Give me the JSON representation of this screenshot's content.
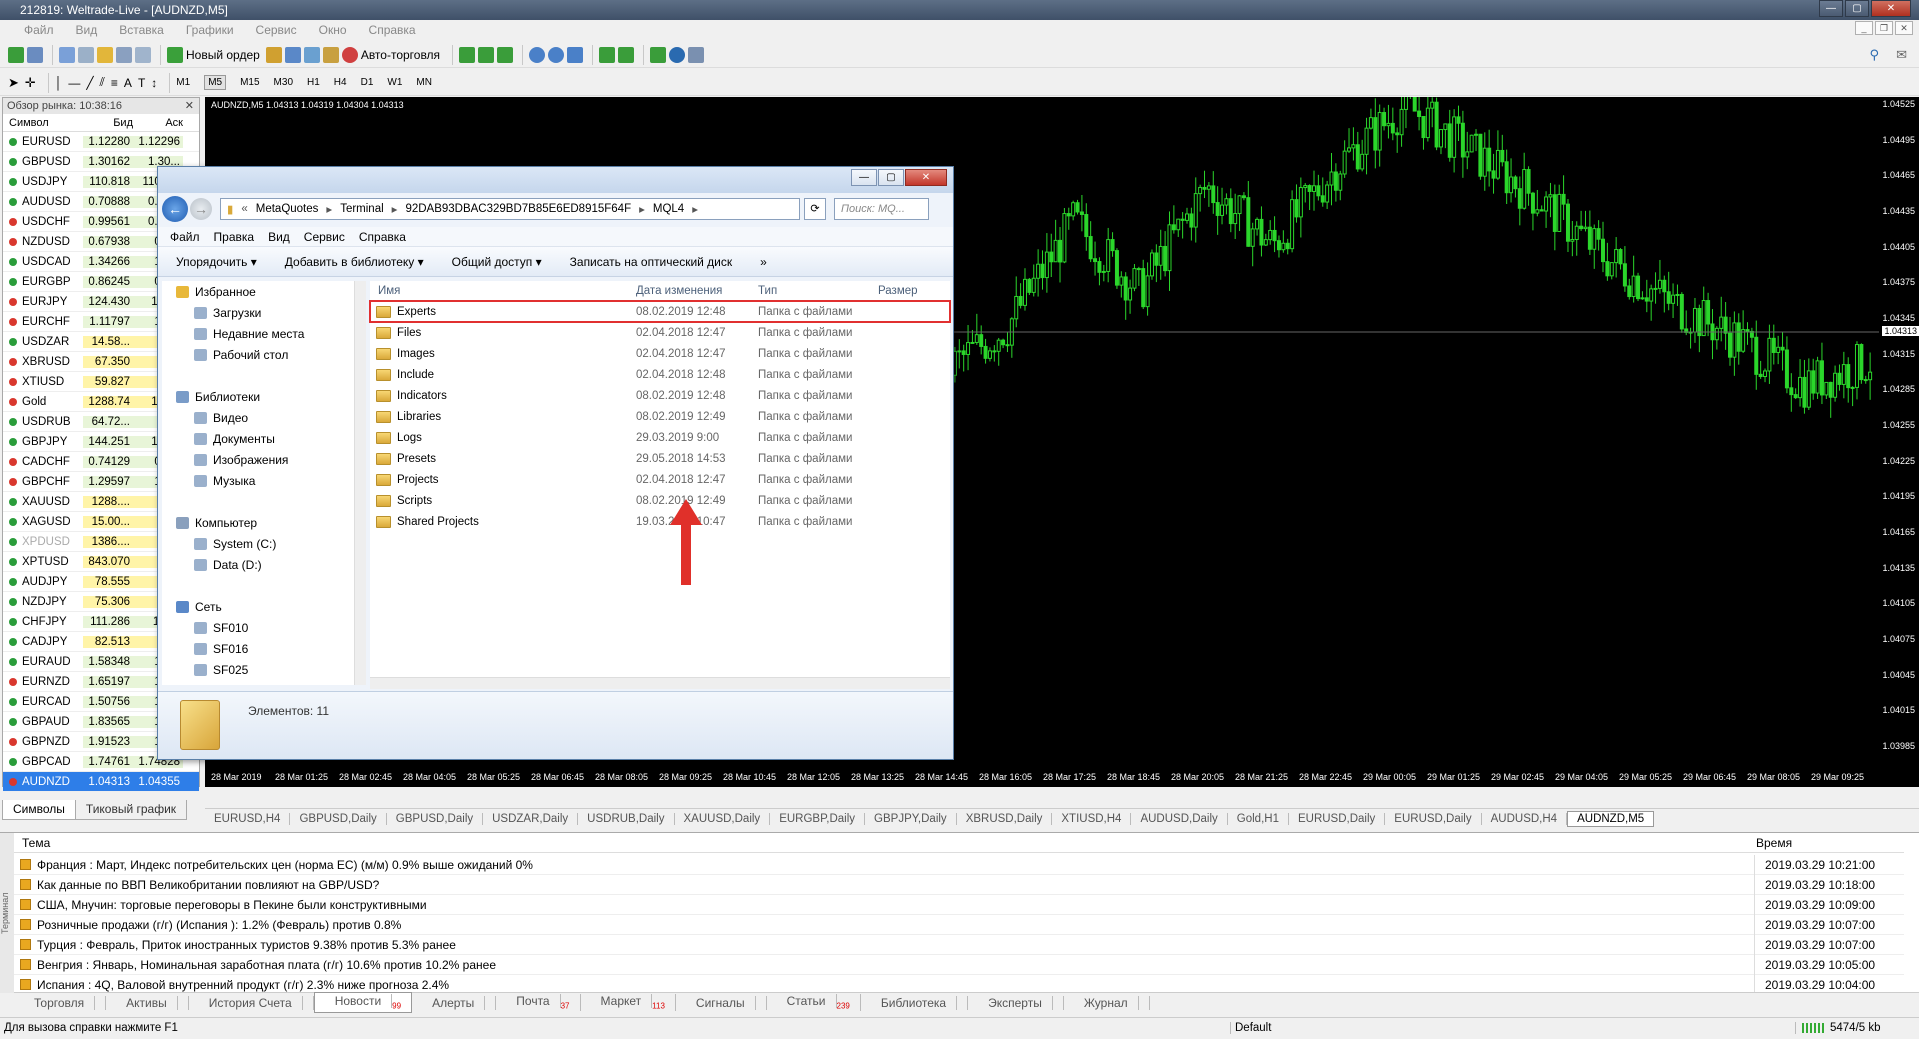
{
  "window": {
    "title": "212819: Weltrade-Live - [AUDNZD,M5]"
  },
  "menu": [
    "Файл",
    "Вид",
    "Вставка",
    "Графики",
    "Сервис",
    "Окно",
    "Справка"
  ],
  "toolbar": {
    "new_order": "Новый ордер",
    "autotrading": "Авто-торговля"
  },
  "timeframes": [
    "M1",
    "M5",
    "M15",
    "M30",
    "H1",
    "H4",
    "D1",
    "W1",
    "MN"
  ],
  "selected_timeframe": "M5",
  "market_watch": {
    "title": "Обзор рынка: 10:38:16",
    "cols": {
      "symbol": "Символ",
      "bid": "Бид",
      "ask": "Аск"
    },
    "rows": [
      {
        "s": "EURUSD",
        "b": "1.12280",
        "a": "1.12296"
      },
      {
        "s": "GBPUSD",
        "b": "1.30162",
        "a": "1.30..."
      },
      {
        "s": "USDJPY",
        "b": "110.818",
        "a": "110.8..."
      },
      {
        "s": "AUDUSD",
        "b": "0.70888",
        "a": "0.70..."
      },
      {
        "s": "USDCHF",
        "b": "0.99561",
        "a": "0.99..."
      },
      {
        "s": "NZDUSD",
        "b": "0.67938",
        "a": "0.6..."
      },
      {
        "s": "USDCAD",
        "b": "1.34266",
        "a": "1.3..."
      },
      {
        "s": "EURGBP",
        "b": "0.86245",
        "a": "0.8..."
      },
      {
        "s": "EURJPY",
        "b": "124.430",
        "a": "124..."
      },
      {
        "s": "EURCHF",
        "b": "1.11797",
        "a": "1.1..."
      },
      {
        "s": "USDZAR",
        "b": "14.58...",
        "a": "14..."
      },
      {
        "s": "XBRUSD",
        "b": "67.350",
        "a": "67..."
      },
      {
        "s": "XTIUSD",
        "b": "59.827",
        "a": "59..."
      },
      {
        "s": "Gold",
        "b": "1288.74",
        "a": "128..."
      },
      {
        "s": "USDRUB",
        "b": "64.72...",
        "a": "64..."
      },
      {
        "s": "GBPJPY",
        "b": "144.251",
        "a": "144..."
      },
      {
        "s": "CADCHF",
        "b": "0.74129",
        "a": "0.7..."
      },
      {
        "s": "GBPCHF",
        "b": "1.29597",
        "a": "1.2..."
      },
      {
        "s": "XAUUSD",
        "b": "1288....",
        "a": "12..."
      },
      {
        "s": "XAGUSD",
        "b": "15.00...",
        "a": "15..."
      },
      {
        "s": "XPDUSD",
        "b": "1386....",
        "a": "13..."
      },
      {
        "s": "XPTUSD",
        "b": "843.070",
        "a": "84..."
      },
      {
        "s": "AUDJPY",
        "b": "78.555",
        "a": "78..."
      },
      {
        "s": "NZDJPY",
        "b": "75.306",
        "a": "75..."
      },
      {
        "s": "CHFJPY",
        "b": "111.286",
        "a": "111..."
      },
      {
        "s": "CADJPY",
        "b": "82.513",
        "a": "82..."
      },
      {
        "s": "EURAUD",
        "b": "1.58348",
        "a": "1.5..."
      },
      {
        "s": "EURNZD",
        "b": "1.65197",
        "a": "1.6..."
      },
      {
        "s": "EURCAD",
        "b": "1.50756",
        "a": "1.5..."
      },
      {
        "s": "GBPAUD",
        "b": "1.83565",
        "a": "1.8..."
      },
      {
        "s": "GBPNZD",
        "b": "1.91523",
        "a": "1.9..."
      },
      {
        "s": "GBPCAD",
        "b": "1.74761",
        "a": "1.74828"
      },
      {
        "s": "AUDNZD",
        "b": "1.04313",
        "a": "1.04355"
      }
    ],
    "tabs": [
      "Символы",
      "Тиковый график"
    ]
  },
  "chart": {
    "info": "AUDNZD,M5 1.04313 1.04319 1.04304 1.04313",
    "price_label": "1.04313"
  },
  "chart_data": {
    "type": "line",
    "yticks": [
      "1.04525",
      "1.04495",
      "1.04465",
      "1.04435",
      "1.04405",
      "1.04375",
      "1.04345",
      "1.04315",
      "1.04285",
      "1.04255",
      "1.04225",
      "1.04195",
      "1.04165",
      "1.04135",
      "1.04105",
      "1.04075",
      "1.04045",
      "1.04015",
      "1.03985"
    ],
    "xticks": [
      "28 Mar 2019",
      "28 Mar 01:25",
      "28 Mar 02:45",
      "28 Mar 04:05",
      "28 Mar 05:25",
      "28 Mar 06:45",
      "28 Mar 08:05",
      "28 Mar 09:25",
      "28 Mar 10:45",
      "28 Mar 12:05",
      "28 Mar 13:25",
      "28 Mar 14:45",
      "28 Mar 16:05",
      "28 Mar 17:25",
      "28 Mar 18:45",
      "28 Mar 20:05",
      "28 Mar 21:25",
      "28 Mar 22:45",
      "29 Mar 00:05",
      "29 Mar 01:25",
      "29 Mar 02:45",
      "29 Mar 04:05",
      "29 Mar 05:25",
      "29 Mar 06:45",
      "29 Mar 08:05",
      "29 Mar 09:25"
    ],
    "ylim": [
      1.0398,
      1.0453
    ],
    "series": [
      {
        "values": [
          1.0408,
          1.0412,
          1.0418,
          1.0424,
          1.0431,
          1.0421,
          1.0413,
          1.0409,
          1.0415,
          1.0422,
          1.0427,
          1.043,
          1.0434,
          1.0443,
          1.0437,
          1.0446,
          1.0441,
          1.0448,
          1.0453,
          1.0449,
          1.0445,
          1.044,
          1.0436,
          1.0433,
          1.0429,
          1.0431
        ]
      }
    ]
  },
  "chart_tabs": [
    "EURUSD,H4",
    "GBPUSD,Daily",
    "GBPUSD,Daily",
    "USDZAR,Daily",
    "USDRUB,Daily",
    "XAUUSD,Daily",
    "EURGBP,Daily",
    "GBPJPY,Daily",
    "XBRUSD,Daily",
    "XTIUSD,H4",
    "AUDUSD,Daily",
    "Gold,H1",
    "EURUSD,Daily",
    "EURUSD,Daily",
    "AUDUSD,H4",
    "AUDNZD,M5"
  ],
  "explorer": {
    "path": [
      "MetaQuotes",
      "Terminal",
      "92DAB93DBAC329BD7B85E6ED8915F64F",
      "MQL4"
    ],
    "search_placeholder": "Поиск: MQ...",
    "menu": [
      "Файл",
      "Правка",
      "Вид",
      "Сервис",
      "Справка"
    ],
    "commands": [
      "Упорядочить ▾",
      "Добавить в библиотеку ▾",
      "Общий доступ ▾",
      "Записать на оптический диск",
      "»"
    ],
    "nav": [
      {
        "t": "Избранное",
        "lvl": "g"
      },
      {
        "t": "Загрузки",
        "lvl": "s"
      },
      {
        "t": "Недавние места",
        "lvl": "s"
      },
      {
        "t": "Рабочий стол",
        "lvl": "s"
      },
      {
        "t": "",
        "lvl": "g"
      },
      {
        "t": "Библиотеки",
        "lvl": "g"
      },
      {
        "t": "Видео",
        "lvl": "s"
      },
      {
        "t": "Документы",
        "lvl": "s"
      },
      {
        "t": "Изображения",
        "lvl": "s"
      },
      {
        "t": "Музыка",
        "lvl": "s"
      },
      {
        "t": "",
        "lvl": "g"
      },
      {
        "t": "Компьютер",
        "lvl": "g"
      },
      {
        "t": "System (C:)",
        "lvl": "s"
      },
      {
        "t": "Data (D:)",
        "lvl": "s"
      },
      {
        "t": "",
        "lvl": "g"
      },
      {
        "t": "Сеть",
        "lvl": "g"
      },
      {
        "t": "SF010",
        "lvl": "s"
      },
      {
        "t": "SF016",
        "lvl": "s"
      },
      {
        "t": "SF025",
        "lvl": "s"
      }
    ],
    "cols": {
      "name": "Имя",
      "date": "Дата изменения",
      "type": "Тип",
      "size": "Размер"
    },
    "files": [
      {
        "n": "Experts",
        "d": "08.02.2019 12:48",
        "k": "Папка с файлами"
      },
      {
        "n": "Files",
        "d": "02.04.2018 12:47",
        "k": "Папка с файлами"
      },
      {
        "n": "Images",
        "d": "02.04.2018 12:47",
        "k": "Папка с файлами"
      },
      {
        "n": "Include",
        "d": "02.04.2018 12:48",
        "k": "Папка с файлами"
      },
      {
        "n": "Indicators",
        "d": "08.02.2019 12:48",
        "k": "Папка с файлами"
      },
      {
        "n": "Libraries",
        "d": "08.02.2019 12:49",
        "k": "Папка с файлами"
      },
      {
        "n": "Logs",
        "d": "29.03.2019 9:00",
        "k": "Папка с файлами"
      },
      {
        "n": "Presets",
        "d": "29.05.2018 14:53",
        "k": "Папка с файлами"
      },
      {
        "n": "Projects",
        "d": "02.04.2018 12:47",
        "k": "Папка с файлами"
      },
      {
        "n": "Scripts",
        "d": "08.02.2019 12:49",
        "k": "Папка с файлами"
      },
      {
        "n": "Shared Projects",
        "d": "19.03.2019 10:47",
        "k": "Папка с файлами"
      }
    ],
    "count": "Элементов: 11"
  },
  "terminal": {
    "side_label": "Терминал",
    "col_topic": "Тема",
    "col_time": "Время",
    "news": [
      {
        "t": "Франция : Март, Индекс потребительских цен (норма ЕС) (м/м)  0.9% выше ожиданий 0%",
        "d": "2019.03.29 10:21:00"
      },
      {
        "t": "Как данные по ВВП Великобритании повлияют на GBP/USD?",
        "d": "2019.03.29 10:18:00"
      },
      {
        "t": "США, Мнучин: торговые переговоры в Пекине были конструктивными",
        "d": "2019.03.29 10:09:00"
      },
      {
        "t": "Розничные продажи (г/г) (Испания ): 1.2% (Февраль) против 0.8%",
        "d": "2019.03.29 10:07:00"
      },
      {
        "t": "Турция : Февраль, Приток иностранных туристов  9.38% против 5.3% ранее",
        "d": "2019.03.29 10:07:00"
      },
      {
        "t": "Венгрия : Январь, Номинальная заработная плата (г/г)  10.6% против 10.2% ранее",
        "d": "2019.03.29 10:05:00"
      },
      {
        "t": "Испания : 4Q, Валовой внутренний продукт  (г/г) 2.3% ниже прогноза 2.4%",
        "d": "2019.03.29 10:04:00"
      }
    ],
    "tabs": [
      {
        "l": "Торговля",
        "c": ""
      },
      {
        "l": "Активы",
        "c": ""
      },
      {
        "l": "История Счета",
        "c": ""
      },
      {
        "l": "Новости",
        "c": "99"
      },
      {
        "l": "Алерты",
        "c": ""
      },
      {
        "l": "Почта",
        "c": "37"
      },
      {
        "l": "Маркет",
        "c": "113"
      },
      {
        "l": "Сигналы",
        "c": ""
      },
      {
        "l": "Статьи",
        "c": "239"
      },
      {
        "l": "Библиотека",
        "c": ""
      },
      {
        "l": "Эксперты",
        "c": ""
      },
      {
        "l": "Журнал",
        "c": ""
      }
    ]
  },
  "status": {
    "help": "Для вызова справки нажмите F1",
    "profile": "Default",
    "traffic": "5474/5 kb"
  },
  "colors": {
    "candle": "#2bd62b",
    "highlight": "#e13030",
    "selected_row": "#2e7ee8"
  }
}
